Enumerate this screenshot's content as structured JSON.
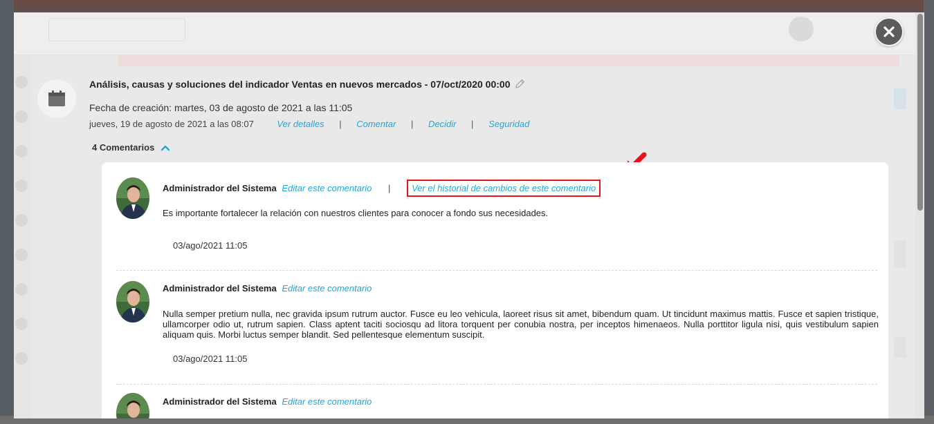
{
  "modal": {
    "title": "Análisis, causas y soluciones del indicador Ventas en nuevos mercados - 07/oct/2020 00:00",
    "created": "Fecha de creación: martes, 03 de agosto de 2021 a las 11:05",
    "date_line": "jueves, 19 de agosto de 2021 a las 08:07",
    "links": {
      "details": "Ver detalles",
      "comment": "Comentar",
      "decide": "Decidir",
      "security": "Seguridad",
      "separator": "|"
    },
    "comments_count": "4 Comentarios"
  },
  "comments": [
    {
      "author": "Administrador del Sistema",
      "edit_label": "Editar este comentario",
      "history_label": "Ver el historial de cambios de este comentario",
      "body": "Es importante fortalecer la relación con nuestros clientes para conocer a fondo sus necesidades.",
      "date": "03/ago/2021 11:05"
    },
    {
      "author": "Administrador del Sistema",
      "edit_label": "Editar este comentario",
      "body": "Nulla semper pretium nulla, nec gravida ipsum rutrum auctor. Fusce eu leo vehicula, laoreet risus sit amet, bibendum quam. Ut tincidunt maximus mattis. Fusce et sapien tristique, ullamcorper odio ut, rutrum sapien. Class aptent taciti sociosqu ad litora torquent per conubia nostra, per inceptos himenaeos. Nulla porttitor ligula nisi, quis vestibulum sapien aliquam quis. Morbi luctus semper blandit. Sed pellentesque elementum suscipit.",
      "date": "03/ago/2021 11:05"
    },
    {
      "author": "Administrador del Sistema",
      "edit_label": "Editar este comentario"
    }
  ],
  "colors": {
    "link": "#1ba8e0",
    "highlight": "#e8131a",
    "close_button": "#5c5c5c"
  },
  "icons": [
    "close-icon",
    "calendar-icon",
    "pencil-icon",
    "chevron-up-icon",
    "red-arrow-icon"
  ]
}
